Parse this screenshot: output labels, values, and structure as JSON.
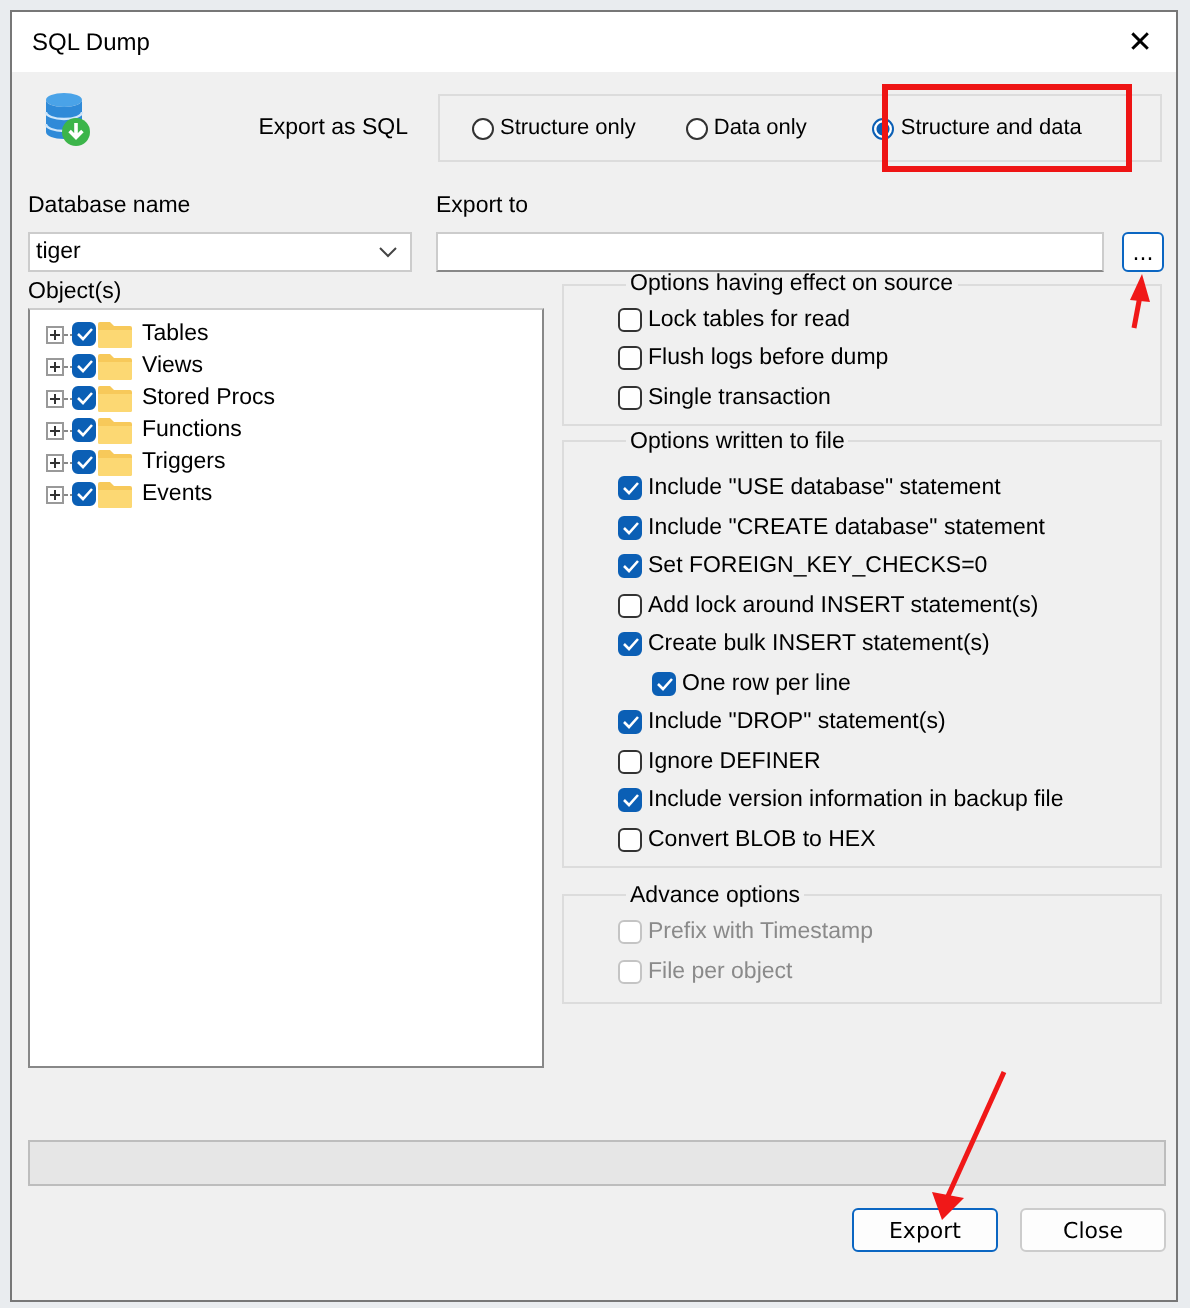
{
  "window": {
    "title": "SQL Dump",
    "close": "✕"
  },
  "export_as": {
    "label": "Export as SQL",
    "options": [
      {
        "label": "Structure only",
        "selected": false
      },
      {
        "label": "Data only",
        "selected": false
      },
      {
        "label": "Structure and data",
        "selected": true
      }
    ]
  },
  "database": {
    "label": "Database name",
    "value": "tiger"
  },
  "export_to": {
    "label": "Export to",
    "button": "..."
  },
  "objects": {
    "label": "Object(s)",
    "items": [
      {
        "label": "Tables",
        "checked": true,
        "expanded": false
      },
      {
        "label": "Views",
        "checked": true,
        "expanded": false
      },
      {
        "label": "Stored Procs",
        "checked": true,
        "expanded": false
      },
      {
        "label": "Functions",
        "checked": true,
        "expanded": false
      },
      {
        "label": "Triggers",
        "checked": true,
        "expanded": false
      },
      {
        "label": "Events",
        "checked": true,
        "expanded": false
      }
    ]
  },
  "groups": [
    {
      "title": "Options having effect on source",
      "items": [
        {
          "label": "Lock tables for read",
          "checked": false,
          "disabled": false
        },
        {
          "label": "Flush logs before dump",
          "checked": false,
          "disabled": false
        },
        {
          "label": "Single transaction",
          "checked": false,
          "disabled": false
        }
      ]
    },
    {
      "title": "Options written to file",
      "items": [
        {
          "label": "Include \"USE database\" statement",
          "checked": true,
          "disabled": false
        },
        {
          "label": "Include \"CREATE database\" statement",
          "checked": true,
          "disabled": false
        },
        {
          "label": "Set FOREIGN_KEY_CHECKS=0",
          "checked": true,
          "disabled": false
        },
        {
          "label": "Add lock around INSERT statement(s)",
          "checked": false,
          "disabled": false
        },
        {
          "label": "Create bulk INSERT statement(s)",
          "checked": true,
          "disabled": false,
          "children": [
            {
              "label": "One row per line",
              "checked": true,
              "disabled": false
            }
          ]
        },
        {
          "label": "Include \"DROP\" statement(s)",
          "checked": true,
          "disabled": false
        },
        {
          "label": "Ignore DEFINER",
          "checked": false,
          "disabled": false
        },
        {
          "label": "Include version information in backup file",
          "checked": true,
          "disabled": false
        },
        {
          "label": "Convert BLOB to HEX",
          "checked": false,
          "disabled": false
        }
      ]
    },
    {
      "title": "Advance options",
      "items": [
        {
          "label": "Prefix with Timestamp",
          "checked": false,
          "disabled": true
        },
        {
          "label": "File per object",
          "checked": false,
          "disabled": true
        }
      ]
    }
  ],
  "progress": {
    "level": 0
  },
  "buttons": [
    {
      "label": "Export",
      "default": true
    },
    {
      "label": "Close",
      "default": false
    }
  ]
}
